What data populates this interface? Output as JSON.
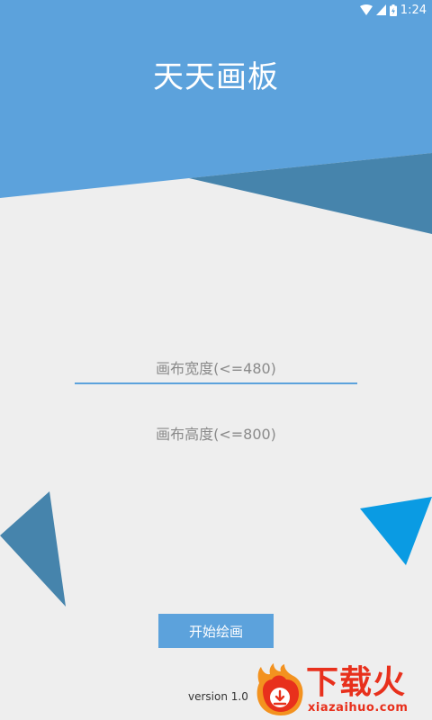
{
  "status_bar": {
    "time": "1:24",
    "icons": [
      "wifi-icon",
      "signal-icon",
      "battery-icon"
    ]
  },
  "app": {
    "title": "天天画板"
  },
  "form": {
    "width_placeholder": "画布宽度(<=480)",
    "height_placeholder": "画布高度(<=800)",
    "width_value": "",
    "height_value": ""
  },
  "actions": {
    "start_label": "开始绘画"
  },
  "footer": {
    "version": "version 1.0"
  },
  "watermark": {
    "title": "下载火",
    "subtitle": "xiazaihuo.com"
  },
  "colors": {
    "header_blue": "#5ca2dc",
    "dark_blue": "#4684ac",
    "bright_blue": "#0a9be3",
    "background": "#eeeeee",
    "watermark_red": "#e8301c"
  }
}
